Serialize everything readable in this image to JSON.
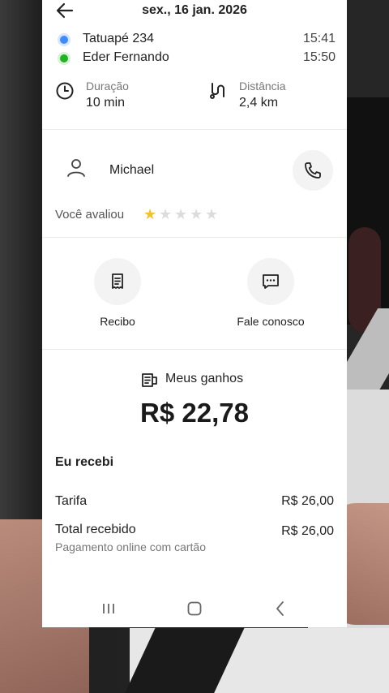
{
  "header": {
    "date": "sex., 16 jan. 2026"
  },
  "route": {
    "pickup": {
      "name": "Tatuapé 234",
      "time": "15:41",
      "color": "#3d8bfd"
    },
    "dropoff": {
      "name": "Eder Fernando",
      "time": "15:50",
      "color": "#22b322"
    }
  },
  "metrics": {
    "duration_label": "Duração",
    "duration_value": "10 min",
    "distance_label": "Distância",
    "distance_value": "2,4 km"
  },
  "passenger": {
    "name": "Michael",
    "rated_label": "Você avaliou",
    "rating": 1,
    "max_rating": 5
  },
  "actions": {
    "receipt_label": "Recibo",
    "contact_label": "Fale conosco"
  },
  "earnings": {
    "title": "Meus ganhos",
    "amount": "R$ 22,78",
    "received_header": "Eu recebi",
    "fare_label": "Tarifa",
    "fare_value": "R$ 26,00",
    "total_label": "Total recebido",
    "total_value": "R$ 26,00",
    "payment_note": "Pagamento online com cartão"
  },
  "colors": {
    "star_on": "#f2c12e",
    "star_off": "#dcdcdc"
  },
  "icons": [
    "back-arrow-icon",
    "clock-icon",
    "route-icon",
    "user-icon",
    "phone-icon",
    "receipt-icon",
    "chat-icon",
    "wallet-icon",
    "recent-apps-icon",
    "home-icon",
    "back-icon"
  ]
}
